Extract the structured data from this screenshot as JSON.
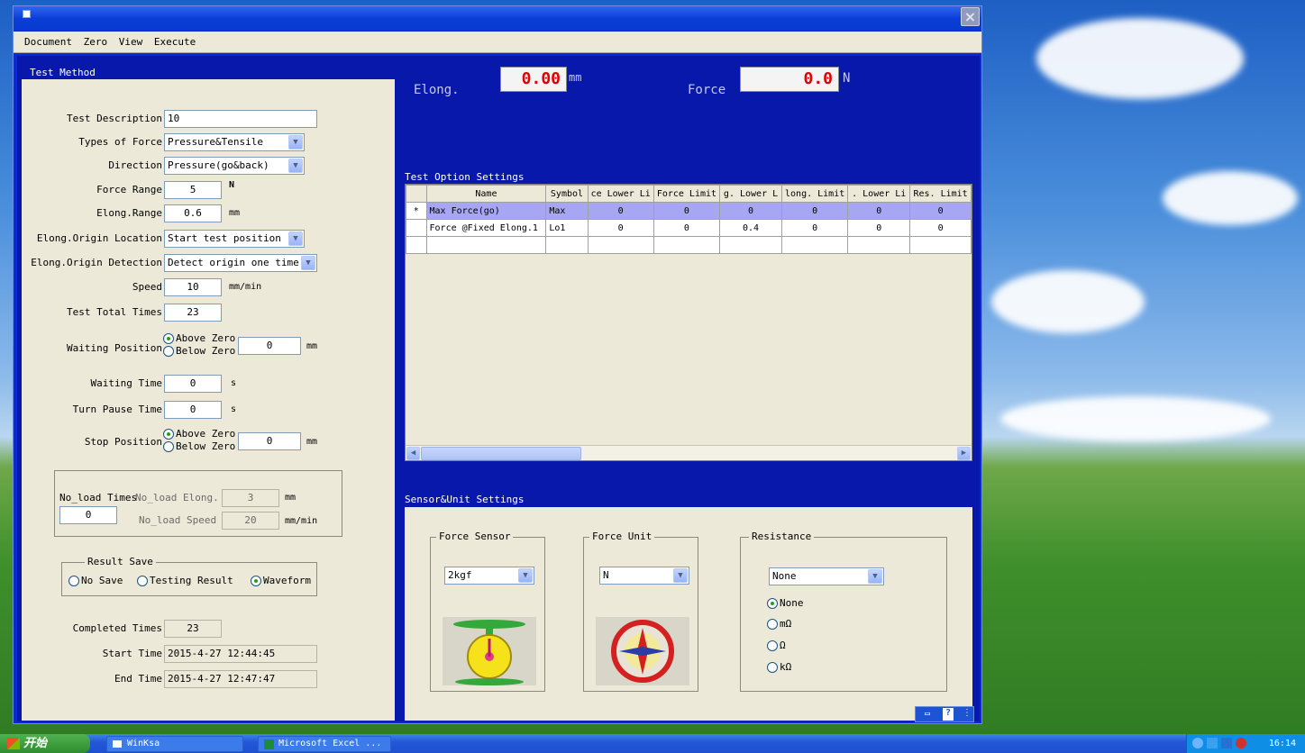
{
  "window": {
    "close_label": "×"
  },
  "menu": [
    "Document",
    "Zero",
    "View",
    "Execute"
  ],
  "sections": {
    "test_method": "Test Method",
    "test_option": "Test Option Settings",
    "sensor_unit": "Sensor&Unit Settings"
  },
  "readouts": {
    "elong_label": "Elong.",
    "elong_value": "0.00",
    "elong_unit": "mm",
    "force_label": "Force",
    "force_value": "0.0",
    "force_unit": "N"
  },
  "form": {
    "test_description": {
      "label": "Test Description",
      "value": "10"
    },
    "types_of_force": {
      "label": "Types of Force",
      "value": "Pressure&Tensile"
    },
    "direction": {
      "label": "Direction",
      "value": "Pressure(go&back)"
    },
    "force_range": {
      "label": "Force Range",
      "value": "5",
      "unit": "N"
    },
    "elong_range": {
      "label": "Elong.Range",
      "value": "0.6",
      "unit": "mm"
    },
    "origin_location": {
      "label": "Elong.Origin Location",
      "value": "Start test position"
    },
    "origin_detection": {
      "label": "Elong.Origin Detection",
      "value": "Detect origin one time"
    },
    "speed": {
      "label": "Speed",
      "value": "10",
      "unit": "mm/min"
    },
    "test_total_times": {
      "label": "Test Total Times",
      "value": "23"
    },
    "waiting_position": {
      "label": "Waiting Position",
      "above": "Above Zero",
      "below": "Below Zero",
      "value": "0",
      "unit": "mm"
    },
    "waiting_time": {
      "label": "Waiting Time",
      "value": "0",
      "unit": "s"
    },
    "turn_pause_time": {
      "label": "Turn Pause Time",
      "value": "0",
      "unit": "s"
    },
    "stop_position": {
      "label": "Stop Position",
      "above": "Above Zero",
      "below": "Below Zero",
      "value": "0",
      "unit": "mm"
    }
  },
  "noload": {
    "times_label": "No_load Times",
    "times_value": "0",
    "elong_label": "No_load Elong.",
    "elong_value": "3",
    "elong_unit": "mm",
    "speed_label": "No_load Speed",
    "speed_value": "20",
    "speed_unit": "mm/min"
  },
  "result_save": {
    "title": "Result Save",
    "options": [
      "No Save",
      "Testing Result",
      "Waveform"
    ],
    "selected": "Waveform"
  },
  "status": {
    "completed_label": "Completed Times",
    "completed_value": "23",
    "start_label": "Start Time",
    "start_value": "2015-4-27 12:44:45",
    "end_label": "End Time",
    "end_value": "2015-4-27 12:47:47"
  },
  "grid": {
    "columns": [
      "Name",
      "Symbol",
      "ce Lower Li",
      "Force Limit",
      "g. Lower L",
      "long. Limit",
      ". Lower Li",
      "Res. Limit"
    ],
    "rows": [
      {
        "marker": "*",
        "cells": [
          "Max Force(go)",
          "Max",
          "0",
          "0",
          "0",
          "0",
          "0",
          "0"
        ]
      },
      {
        "marker": "",
        "cells": [
          "Force @Fixed Elong.1",
          "Lo1",
          "0",
          "0",
          "0.4",
          "0",
          "0",
          "0"
        ]
      },
      {
        "marker": "",
        "cells": [
          "",
          "",
          "",
          "",
          "",
          "",
          "",
          ""
        ]
      }
    ]
  },
  "sensor": {
    "force_sensor": {
      "title": "Force Sensor",
      "value": "2kgf"
    },
    "force_unit": {
      "title": "Force Unit",
      "value": "N"
    },
    "resistance": {
      "title": "Resistance",
      "value": "None",
      "options": [
        "None",
        "mΩ",
        "Ω",
        "kΩ"
      ],
      "selected": "None"
    }
  },
  "taskbar": {
    "start_label": "开始",
    "items": [
      "WinKsa",
      "Microsoft Excel ..."
    ],
    "clock": "16:14"
  }
}
